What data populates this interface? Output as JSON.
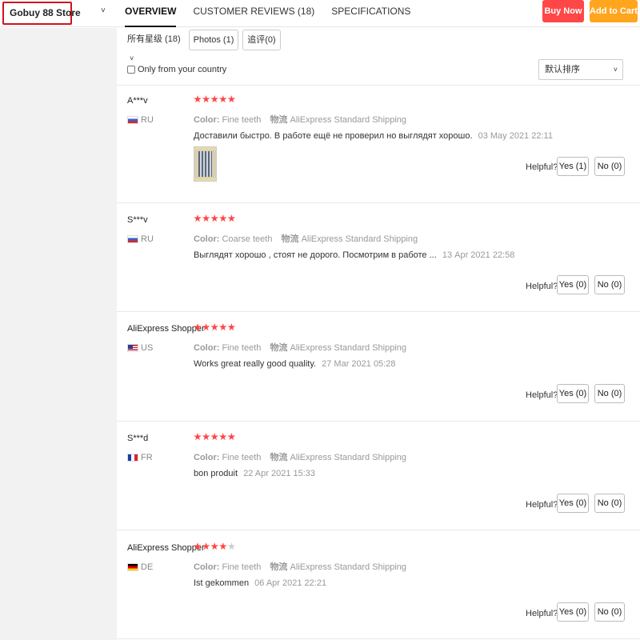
{
  "header": {
    "store_name": "Gobuy 88 Store",
    "store_chevron_icon": "chevron-down-icon",
    "tabs": [
      {
        "label": "OVERVIEW",
        "active": true
      },
      {
        "label": "CUSTOMER REVIEWS (18)",
        "active": false
      },
      {
        "label": "SPECIFICATIONS",
        "active": false
      }
    ],
    "buy_now": "Buy Now",
    "add_to_cart": "Add to Cart",
    "colors": {
      "buy_now": "#ff4747",
      "add_to_cart": "#ffa51e",
      "store_border": "#d0121b"
    }
  },
  "filters": {
    "all_stars": "所有星级 (18)",
    "photos": "Photos (1)",
    "appended": "追评(0)",
    "only_country": "Only from your country",
    "sort": "默认排序"
  },
  "reviews": [
    {
      "name": "A***v",
      "country": "RU",
      "flag": "ru",
      "rating": 5,
      "color_label": "Color:",
      "color_value": "Fine teeth",
      "shipping_label": "物流",
      "shipping_value": "AliExpress Standard Shipping",
      "text": "Доставили быстро. В работе ещё не проверил но выглядят хорошо.",
      "date": "03 May 2021 22:11",
      "has_photo": true,
      "helpful": "Helpful?",
      "yes": "Yes (1)",
      "no": "No (0)"
    },
    {
      "name": "S***v",
      "country": "RU",
      "flag": "ru",
      "rating": 5,
      "color_label": "Color:",
      "color_value": "Coarse teeth",
      "shipping_label": "物流",
      "shipping_value": "AliExpress Standard Shipping",
      "text": "Выглядят хорошо , стоят не дорого. Посмотрим в работе ...",
      "date": "13 Apr 2021 22:58",
      "has_photo": false,
      "helpful": "Helpful?",
      "yes": "Yes (0)",
      "no": "No (0)"
    },
    {
      "name": "AliExpress Shopper",
      "country": "US",
      "flag": "us",
      "rating": 5,
      "color_label": "Color:",
      "color_value": "Fine teeth",
      "shipping_label": "物流",
      "shipping_value": "AliExpress Standard Shipping",
      "text": "Works great really good quality.",
      "date": "27 Mar 2021 05:28",
      "has_photo": false,
      "helpful": "Helpful?",
      "yes": "Yes (0)",
      "no": "No (0)"
    },
    {
      "name": "S***d",
      "country": "FR",
      "flag": "fr",
      "rating": 5,
      "color_label": "Color:",
      "color_value": "Fine teeth",
      "shipping_label": "物流",
      "shipping_value": "AliExpress Standard Shipping",
      "text": "bon produit",
      "date": "22 Apr 2021 15:33",
      "has_photo": false,
      "helpful": "Helpful?",
      "yes": "Yes (0)",
      "no": "No (0)"
    },
    {
      "name": "AliExpress Shopper",
      "country": "DE",
      "flag": "de",
      "rating": 4,
      "color_label": "Color:",
      "color_value": "Fine teeth",
      "shipping_label": "物流",
      "shipping_value": "AliExpress Standard Shipping",
      "text": "Ist gekommen",
      "date": "06 Apr 2021 22:21",
      "has_photo": false,
      "helpful": "Helpful?",
      "yes": "Yes (0)",
      "no": "No (0)"
    }
  ]
}
